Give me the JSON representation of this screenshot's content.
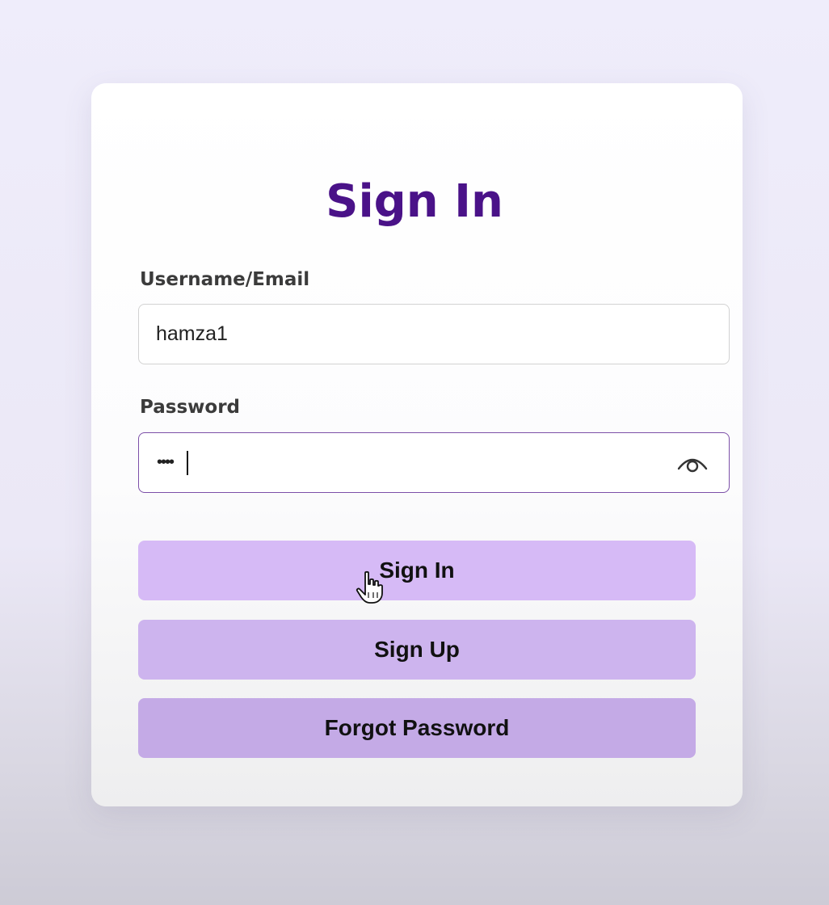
{
  "form": {
    "title": "Sign In",
    "username": {
      "label": "Username/Email",
      "value": "hamza1"
    },
    "password": {
      "label": "Password",
      "masked_value": "••••",
      "toggle_icon": "eye-icon"
    },
    "buttons": {
      "sign_in": "Sign In",
      "sign_up": "Sign Up",
      "forgot_password": "Forgot Password"
    }
  },
  "colors": {
    "title": "#4a1288",
    "button": "#d6baf6",
    "focus_border": "#7c4fa8"
  }
}
